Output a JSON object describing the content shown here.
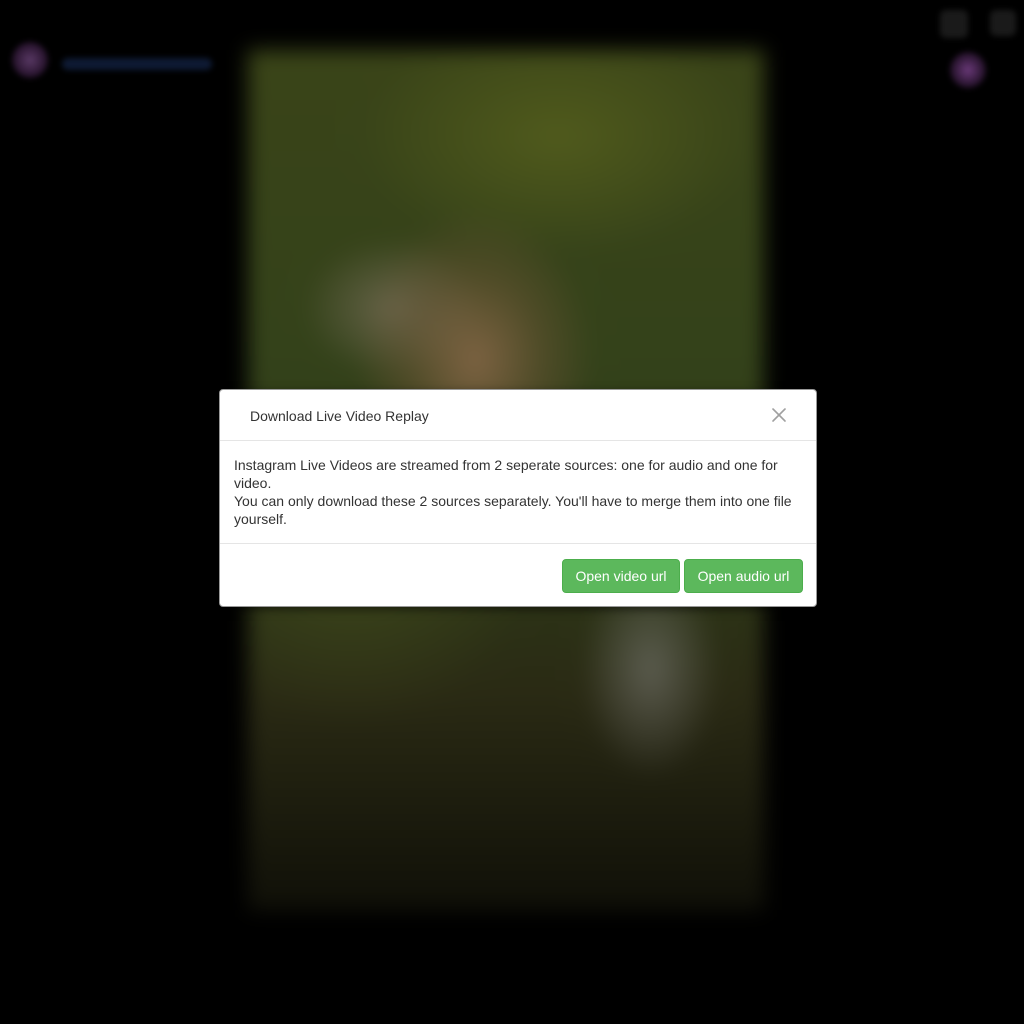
{
  "modal": {
    "title": "Download Live Video Replay",
    "close_icon": "close-icon",
    "body_lines": [
      "Instagram Live Videos are streamed from 2 seperate sources: one for audio and one for video.",
      "You can only download these 2 sources separately. You'll have to merge them into one file yourself."
    ],
    "buttons": {
      "open_video": "Open video url",
      "open_audio": "Open audio url"
    }
  },
  "colors": {
    "overlay": "#000000",
    "button_success": "#5cb85c",
    "button_success_border": "#4cae4c",
    "modal_text": "#333333"
  }
}
